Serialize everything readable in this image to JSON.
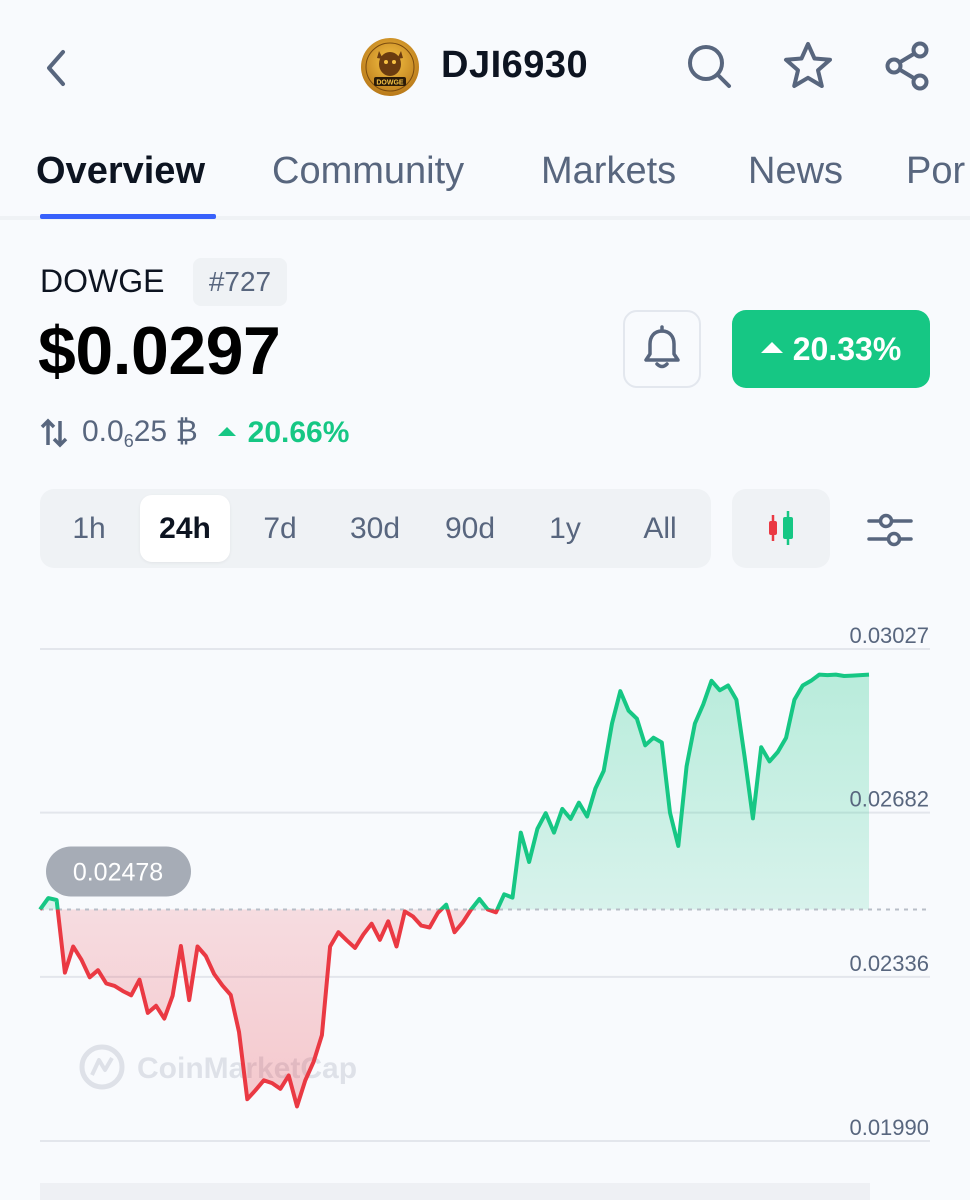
{
  "header": {
    "symbol": "DJI6930",
    "logo_text": "DOWGE",
    "icons": [
      "back-icon",
      "search-icon",
      "star-icon",
      "share-icon"
    ]
  },
  "tabs": [
    {
      "label": "Overview",
      "active": true
    },
    {
      "label": "Community",
      "active": false
    },
    {
      "label": "Markets",
      "active": false
    },
    {
      "label": "News",
      "active": false
    },
    {
      "label": "Por",
      "active": false
    }
  ],
  "coin": {
    "name": "DOWGE",
    "rank": "#727",
    "price": "$0.0297",
    "change_24h": "20.33%",
    "btc_price_prefix": "0.0",
    "btc_price_sub": "6",
    "btc_price_suffix": "25 ₿",
    "btc_change": "20.66%"
  },
  "range": {
    "options": [
      "1h",
      "24h",
      "7d",
      "30d",
      "90d",
      "1y",
      "All"
    ],
    "selected": "24h"
  },
  "colors": {
    "accent": "#3861fb",
    "up": "#16c784",
    "down": "#ea3943",
    "text_primary": "#0d1421",
    "text_secondary": "#58667e"
  },
  "chart_data": {
    "type": "line",
    "ylim": [
      0.019,
      0.03027
    ],
    "y_ticks": [
      "0.03027",
      "0.02682",
      "0.02336",
      "0.01990"
    ],
    "y_tick_values": [
      0.03027,
      0.02682,
      0.02336,
      0.0199
    ],
    "reference_value": 0.02478,
    "reference_label": "0.02478",
    "watermark": "CoinMarketCap",
    "series": [
      {
        "x": [
          0,
          1,
          2,
          3,
          4,
          5,
          6,
          7,
          8,
          9,
          10,
          11,
          12,
          13,
          14,
          15,
          16,
          17,
          18,
          19,
          20,
          21,
          22,
          23,
          24,
          25,
          26,
          27,
          28,
          29,
          30,
          31,
          32,
          33,
          34,
          35,
          36,
          37,
          38,
          39,
          40,
          41,
          42,
          43,
          44,
          45,
          46,
          47,
          48,
          49,
          50,
          51,
          52,
          53,
          54,
          55,
          56,
          57,
          58,
          59,
          60,
          61,
          62,
          63,
          64,
          65,
          66,
          67,
          68,
          69,
          70,
          71,
          72,
          73,
          74,
          75,
          76,
          77,
          78,
          79,
          80,
          81,
          82,
          83,
          84,
          85,
          86,
          87,
          88,
          89,
          90,
          91,
          92,
          93,
          94,
          95,
          96,
          97,
          98,
          99,
          100
        ],
        "values": [
          0.02478,
          0.02502,
          0.02498,
          0.02345,
          0.024,
          0.02372,
          0.02335,
          0.0235,
          0.02322,
          0.02317,
          0.02306,
          0.02297,
          0.0233,
          0.0226,
          0.02275,
          0.02248,
          0.02296,
          0.02401,
          0.02287,
          0.024,
          0.0238,
          0.02342,
          0.02318,
          0.02298,
          0.0222,
          0.02078,
          0.02097,
          0.02118,
          0.02112,
          0.021,
          0.02128,
          0.02063,
          0.02118,
          0.02157,
          0.02213,
          0.024,
          0.0243,
          0.02413,
          0.02397,
          0.02425,
          0.02448,
          0.02414,
          0.02453,
          0.024,
          0.02474,
          0.02463,
          0.02444,
          0.0244,
          0.02471,
          0.02488,
          0.0243,
          0.02451,
          0.02478,
          0.025,
          0.02478,
          0.02472,
          0.0251,
          0.02503,
          0.0264,
          0.02578,
          0.02648,
          0.02681,
          0.0264,
          0.0269,
          0.02669,
          0.02703,
          0.02674,
          0.02733,
          0.0277,
          0.0287,
          0.02938,
          0.02897,
          0.0288,
          0.02824,
          0.0284,
          0.0283,
          0.02682,
          0.02612,
          0.0278,
          0.0287,
          0.0291,
          0.0296,
          0.0294,
          0.0295,
          0.0292,
          0.028,
          0.0267,
          0.0282,
          0.0279,
          0.0281,
          0.0284,
          0.0292,
          0.0295,
          0.0296,
          0.02973,
          0.02972,
          0.02973,
          0.0297,
          0.02971,
          0.02972,
          0.02973
        ]
      }
    ]
  }
}
